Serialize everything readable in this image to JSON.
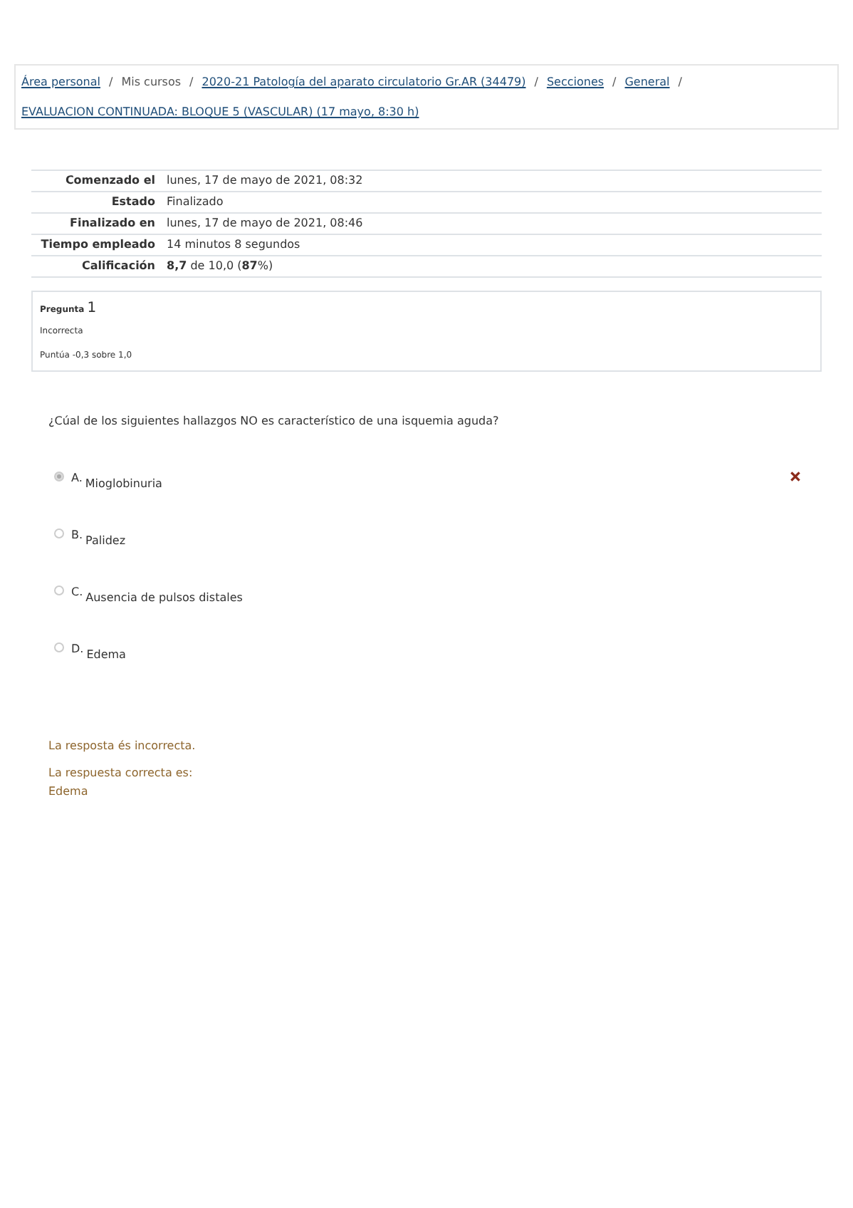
{
  "breadcrumb": [
    {
      "label": "Área personal",
      "link": true
    },
    {
      "separator": "/",
      "label": "Mis cursos",
      "link": false
    },
    {
      "separator": "/",
      "label": "2020-21 Patología del aparato circulatorio Gr.AR (34479)",
      "link": true
    },
    {
      "separator": "/",
      "label": "Secciones",
      "link": true
    },
    {
      "separator": "/",
      "label": "General",
      "link": true
    },
    {
      "separator": "/",
      "label": "EVALUACION CONTINUADA: BLOQUE 5 (VASCULAR) (17 mayo, 8:30 h)",
      "link": true
    }
  ],
  "summary": [
    {
      "label": "Comenzado el",
      "value": "lunes, 17 de mayo de 2021, 08:32"
    },
    {
      "label": "Estado",
      "value": "Finalizado"
    },
    {
      "label": "Finalizado en",
      "value": "lunes, 17 de mayo de 2021, 08:46"
    },
    {
      "label": "Tiempo empleado",
      "value": "14 minutos 8 segundos"
    },
    {
      "label": "Calificación",
      "value": "**8,7** de 10,0 (**87**%)"
    }
  ],
  "question_info": {
    "label": "Pregunta",
    "number": "1",
    "state": "Incorrecta",
    "score": "Puntúa -0,3 sobre 1,0"
  },
  "question": "¿Cúal de los siguientes hallazgos NO es característico de una isquemia aguda?",
  "options": [
    {
      "letter": "A.",
      "text": "Mioglobinuria",
      "selected": true,
      "incorrect": true
    },
    {
      "letter": "B.",
      "text": "Palidez",
      "selected": false,
      "incorrect": false
    },
    {
      "letter": "C.",
      "text": "Ausencia de pulsos distales",
      "selected": false,
      "incorrect": false
    },
    {
      "letter": "D.",
      "text": "Edema",
      "selected": false,
      "incorrect": false
    }
  ],
  "feedback": {
    "result": "La resposta és incorrecta.",
    "correct_label": "La respuesta correcta es:",
    "correct_answer": "Edema"
  }
}
